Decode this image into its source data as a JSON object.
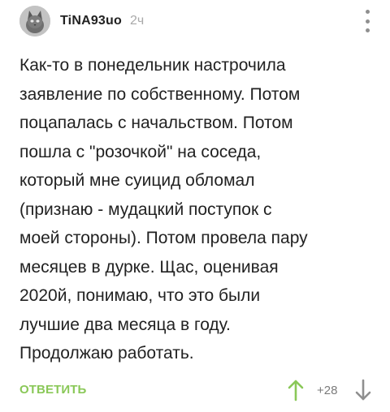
{
  "comment": {
    "author": "TiNA93uo",
    "time": "2ч",
    "avatar_icon": "cat-avatar-icon",
    "more_icon": "more-vertical-icon",
    "text": "Как-то в понедельник настрочила\nзаявление по собственному. Потом\nпоцапалась с начальством. Потом\nпошла с \"розочкой\" на соседа,\nкоторый мне суицид обломал\n(признаю - мудацкий поступок с\nмоей стороны). Потом провела пару\nмесяцев в дурке. Щас, оценивая\n2020й, понимаю, что это были\nлучшие два месяца в году.\nПродолжаю работать.",
    "reply_label": "ОТВЕТИТЬ",
    "rating": "+28",
    "vote_up_icon": "arrow-up-icon",
    "vote_down_icon": "arrow-down-icon"
  },
  "colors": {
    "accent_green": "#8ac858",
    "author_text": "#222222",
    "muted_text": "#a9a9a9",
    "icon_gray": "#8f8f8f"
  }
}
